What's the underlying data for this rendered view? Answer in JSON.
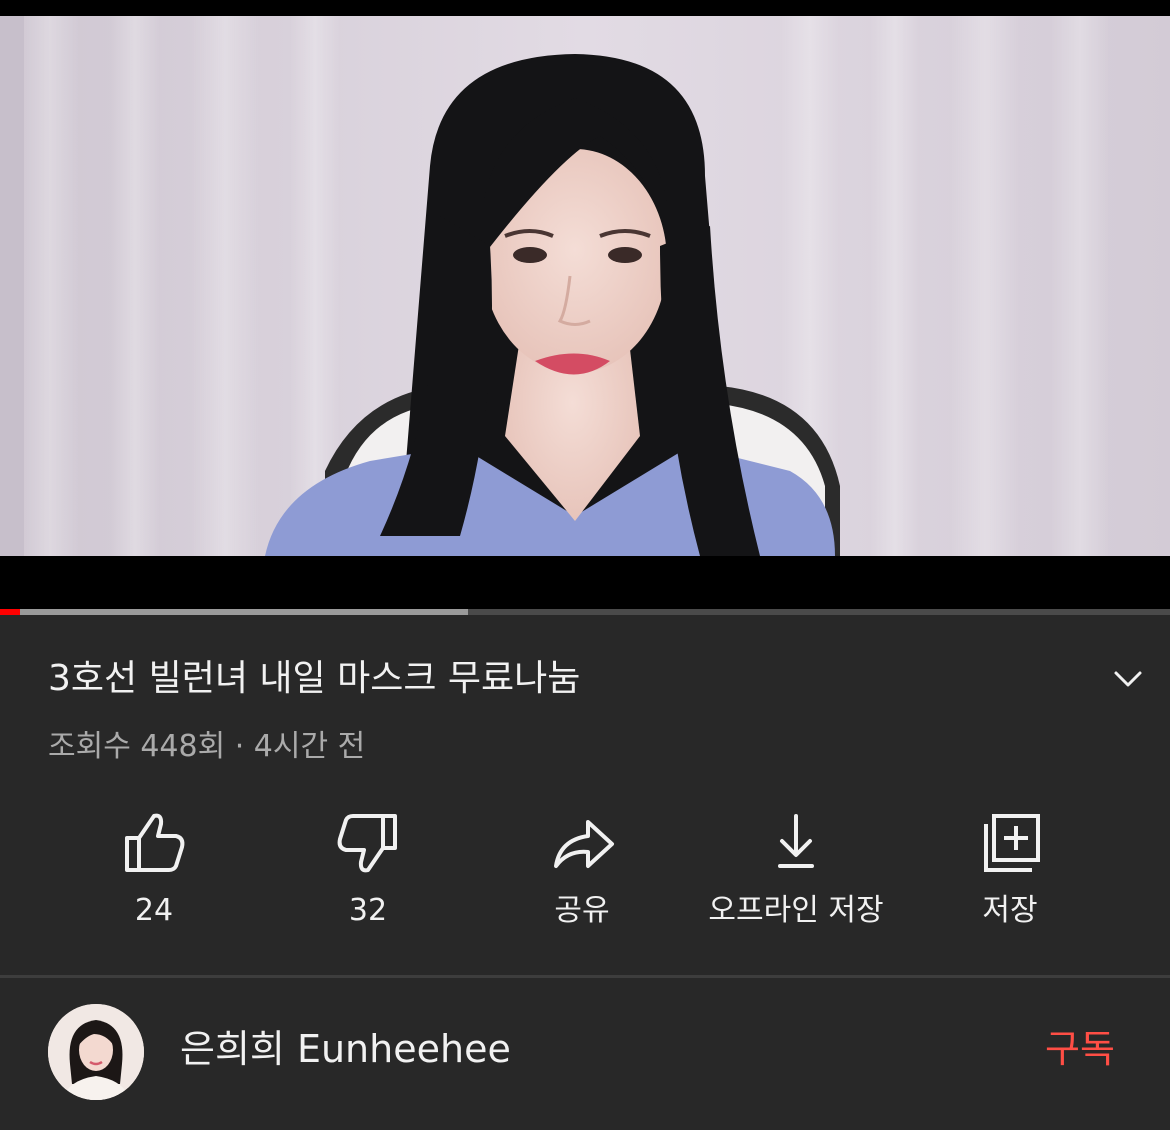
{
  "video": {
    "progress_played_fraction": 0.017,
    "progress_buffered_fraction": 0.4
  },
  "title": "3호선 빌런녀 내일 마스크 무료나눔",
  "meta": "조회수 448회 · 4시간 전",
  "actions": {
    "like_count": "24",
    "dislike_count": "32",
    "share_label": "공유",
    "download_label": "오프라인 저장",
    "save_label": "저장"
  },
  "icons": {
    "like": "thumbs-up-icon",
    "dislike": "thumbs-down-icon",
    "share": "share-arrow-icon",
    "download": "download-icon",
    "save": "playlist-add-icon",
    "expand": "chevron-down-icon"
  },
  "channel": {
    "name": "은희희 Eunheehee",
    "subscribe_label": "구독"
  },
  "colors": {
    "background": "#282828",
    "accent": "#ff0000",
    "subscribe": "#ff4e45",
    "text_primary": "#f1f1f1",
    "text_secondary": "#aaaaaa"
  }
}
